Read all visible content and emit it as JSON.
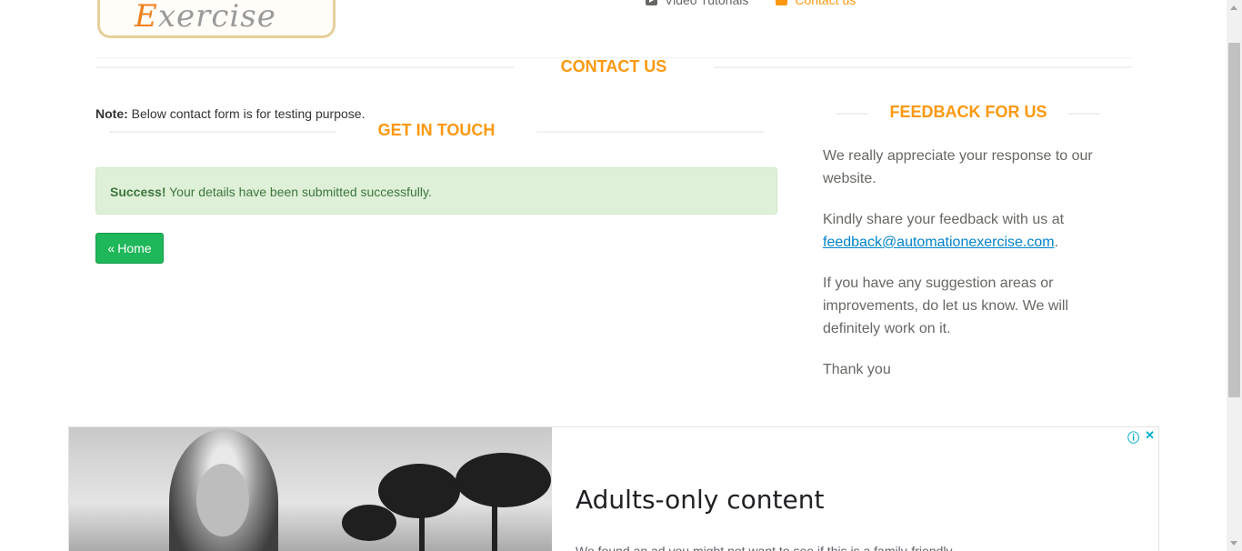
{
  "header": {
    "logo": {
      "first_letter": "E",
      "rest": "xercise"
    },
    "nav": [
      {
        "label": "Video Tutorials",
        "icon": "video-icon"
      },
      {
        "label": "Contact us",
        "icon": "envelope-icon",
        "active": true
      }
    ]
  },
  "contact": {
    "title": "CONTACT US",
    "note_label": "Note:",
    "note_text": " Below contact form is for testing purpose.",
    "get_in_touch": "GET IN TOUCH",
    "success_label": "Success!",
    "success_text": " Your details have been submitted successfully.",
    "home_icon": "«",
    "home_label": "Home"
  },
  "feedback": {
    "title": "FEEDBACK FOR US",
    "p1": "We really appreciate your response to our website.",
    "p2_prefix": "Kindly share your feedback with us at ",
    "email": "feedback@automationexercise.com",
    "p2_suffix": ".",
    "p3": "If you have any suggestion areas or improvements, do let us know. We will definitely work on it.",
    "p4": "Thank you"
  },
  "ad": {
    "headline": "Adults-only content",
    "subtext": "We found an ad you might not want to see if this is a family-friendly...",
    "info_icon": "ⓘ",
    "close_icon": "✕"
  },
  "colors": {
    "accent": "#fe980f",
    "success_bg": "#dff0d8",
    "success_text": "#3c763d",
    "button_green": "#1eb75a",
    "link": "#0083c9"
  }
}
